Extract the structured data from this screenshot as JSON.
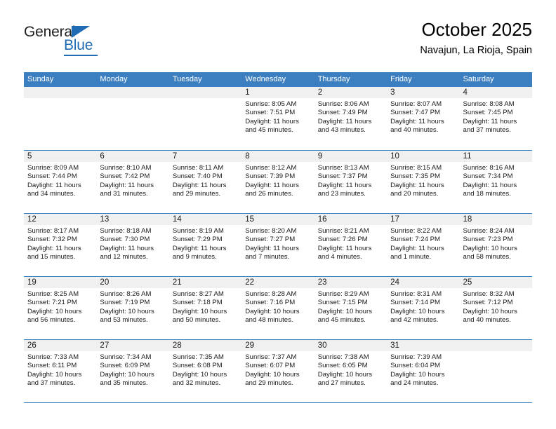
{
  "brand": {
    "name_part1": "General",
    "name_part2": "Blue",
    "triangle_icon": "blue-triangle",
    "accent_color": "#1f6cb4"
  },
  "header": {
    "title": "October 2025",
    "subtitle": "Navajun, La Rioja, Spain"
  },
  "theme": {
    "header_row_color": "#3b7fc0",
    "day_band_color": "#f0f0f0",
    "text_color": "#1a1a1a"
  },
  "weekday_headers": [
    "Sunday",
    "Monday",
    "Tuesday",
    "Wednesday",
    "Thursday",
    "Friday",
    "Saturday"
  ],
  "weeks": [
    [
      {
        "day": "",
        "sunrise": "",
        "sunset": "",
        "daylight_line1": "",
        "daylight_line2": ""
      },
      {
        "day": "",
        "sunrise": "",
        "sunset": "",
        "daylight_line1": "",
        "daylight_line2": ""
      },
      {
        "day": "",
        "sunrise": "",
        "sunset": "",
        "daylight_line1": "",
        "daylight_line2": ""
      },
      {
        "day": "1",
        "sunrise": "Sunrise: 8:05 AM",
        "sunset": "Sunset: 7:51 PM",
        "daylight_line1": "Daylight: 11 hours",
        "daylight_line2": "and 45 minutes."
      },
      {
        "day": "2",
        "sunrise": "Sunrise: 8:06 AM",
        "sunset": "Sunset: 7:49 PM",
        "daylight_line1": "Daylight: 11 hours",
        "daylight_line2": "and 43 minutes."
      },
      {
        "day": "3",
        "sunrise": "Sunrise: 8:07 AM",
        "sunset": "Sunset: 7:47 PM",
        "daylight_line1": "Daylight: 11 hours",
        "daylight_line2": "and 40 minutes."
      },
      {
        "day": "4",
        "sunrise": "Sunrise: 8:08 AM",
        "sunset": "Sunset: 7:45 PM",
        "daylight_line1": "Daylight: 11 hours",
        "daylight_line2": "and 37 minutes."
      }
    ],
    [
      {
        "day": "5",
        "sunrise": "Sunrise: 8:09 AM",
        "sunset": "Sunset: 7:44 PM",
        "daylight_line1": "Daylight: 11 hours",
        "daylight_line2": "and 34 minutes."
      },
      {
        "day": "6",
        "sunrise": "Sunrise: 8:10 AM",
        "sunset": "Sunset: 7:42 PM",
        "daylight_line1": "Daylight: 11 hours",
        "daylight_line2": "and 31 minutes."
      },
      {
        "day": "7",
        "sunrise": "Sunrise: 8:11 AM",
        "sunset": "Sunset: 7:40 PM",
        "daylight_line1": "Daylight: 11 hours",
        "daylight_line2": "and 29 minutes."
      },
      {
        "day": "8",
        "sunrise": "Sunrise: 8:12 AM",
        "sunset": "Sunset: 7:39 PM",
        "daylight_line1": "Daylight: 11 hours",
        "daylight_line2": "and 26 minutes."
      },
      {
        "day": "9",
        "sunrise": "Sunrise: 8:13 AM",
        "sunset": "Sunset: 7:37 PM",
        "daylight_line1": "Daylight: 11 hours",
        "daylight_line2": "and 23 minutes."
      },
      {
        "day": "10",
        "sunrise": "Sunrise: 8:15 AM",
        "sunset": "Sunset: 7:35 PM",
        "daylight_line1": "Daylight: 11 hours",
        "daylight_line2": "and 20 minutes."
      },
      {
        "day": "11",
        "sunrise": "Sunrise: 8:16 AM",
        "sunset": "Sunset: 7:34 PM",
        "daylight_line1": "Daylight: 11 hours",
        "daylight_line2": "and 18 minutes."
      }
    ],
    [
      {
        "day": "12",
        "sunrise": "Sunrise: 8:17 AM",
        "sunset": "Sunset: 7:32 PM",
        "daylight_line1": "Daylight: 11 hours",
        "daylight_line2": "and 15 minutes."
      },
      {
        "day": "13",
        "sunrise": "Sunrise: 8:18 AM",
        "sunset": "Sunset: 7:30 PM",
        "daylight_line1": "Daylight: 11 hours",
        "daylight_line2": "and 12 minutes."
      },
      {
        "day": "14",
        "sunrise": "Sunrise: 8:19 AM",
        "sunset": "Sunset: 7:29 PM",
        "daylight_line1": "Daylight: 11 hours",
        "daylight_line2": "and 9 minutes."
      },
      {
        "day": "15",
        "sunrise": "Sunrise: 8:20 AM",
        "sunset": "Sunset: 7:27 PM",
        "daylight_line1": "Daylight: 11 hours",
        "daylight_line2": "and 7 minutes."
      },
      {
        "day": "16",
        "sunrise": "Sunrise: 8:21 AM",
        "sunset": "Sunset: 7:26 PM",
        "daylight_line1": "Daylight: 11 hours",
        "daylight_line2": "and 4 minutes."
      },
      {
        "day": "17",
        "sunrise": "Sunrise: 8:22 AM",
        "sunset": "Sunset: 7:24 PM",
        "daylight_line1": "Daylight: 11 hours",
        "daylight_line2": "and 1 minute."
      },
      {
        "day": "18",
        "sunrise": "Sunrise: 8:24 AM",
        "sunset": "Sunset: 7:23 PM",
        "daylight_line1": "Daylight: 10 hours",
        "daylight_line2": "and 58 minutes."
      }
    ],
    [
      {
        "day": "19",
        "sunrise": "Sunrise: 8:25 AM",
        "sunset": "Sunset: 7:21 PM",
        "daylight_line1": "Daylight: 10 hours",
        "daylight_line2": "and 56 minutes."
      },
      {
        "day": "20",
        "sunrise": "Sunrise: 8:26 AM",
        "sunset": "Sunset: 7:19 PM",
        "daylight_line1": "Daylight: 10 hours",
        "daylight_line2": "and 53 minutes."
      },
      {
        "day": "21",
        "sunrise": "Sunrise: 8:27 AM",
        "sunset": "Sunset: 7:18 PM",
        "daylight_line1": "Daylight: 10 hours",
        "daylight_line2": "and 50 minutes."
      },
      {
        "day": "22",
        "sunrise": "Sunrise: 8:28 AM",
        "sunset": "Sunset: 7:16 PM",
        "daylight_line1": "Daylight: 10 hours",
        "daylight_line2": "and 48 minutes."
      },
      {
        "day": "23",
        "sunrise": "Sunrise: 8:29 AM",
        "sunset": "Sunset: 7:15 PM",
        "daylight_line1": "Daylight: 10 hours",
        "daylight_line2": "and 45 minutes."
      },
      {
        "day": "24",
        "sunrise": "Sunrise: 8:31 AM",
        "sunset": "Sunset: 7:14 PM",
        "daylight_line1": "Daylight: 10 hours",
        "daylight_line2": "and 42 minutes."
      },
      {
        "day": "25",
        "sunrise": "Sunrise: 8:32 AM",
        "sunset": "Sunset: 7:12 PM",
        "daylight_line1": "Daylight: 10 hours",
        "daylight_line2": "and 40 minutes."
      }
    ],
    [
      {
        "day": "26",
        "sunrise": "Sunrise: 7:33 AM",
        "sunset": "Sunset: 6:11 PM",
        "daylight_line1": "Daylight: 10 hours",
        "daylight_line2": "and 37 minutes."
      },
      {
        "day": "27",
        "sunrise": "Sunrise: 7:34 AM",
        "sunset": "Sunset: 6:09 PM",
        "daylight_line1": "Daylight: 10 hours",
        "daylight_line2": "and 35 minutes."
      },
      {
        "day": "28",
        "sunrise": "Sunrise: 7:35 AM",
        "sunset": "Sunset: 6:08 PM",
        "daylight_line1": "Daylight: 10 hours",
        "daylight_line2": "and 32 minutes."
      },
      {
        "day": "29",
        "sunrise": "Sunrise: 7:37 AM",
        "sunset": "Sunset: 6:07 PM",
        "daylight_line1": "Daylight: 10 hours",
        "daylight_line2": "and 29 minutes."
      },
      {
        "day": "30",
        "sunrise": "Sunrise: 7:38 AM",
        "sunset": "Sunset: 6:05 PM",
        "daylight_line1": "Daylight: 10 hours",
        "daylight_line2": "and 27 minutes."
      },
      {
        "day": "31",
        "sunrise": "Sunrise: 7:39 AM",
        "sunset": "Sunset: 6:04 PM",
        "daylight_line1": "Daylight: 10 hours",
        "daylight_line2": "and 24 minutes."
      },
      {
        "day": "",
        "sunrise": "",
        "sunset": "",
        "daylight_line1": "",
        "daylight_line2": ""
      }
    ]
  ]
}
